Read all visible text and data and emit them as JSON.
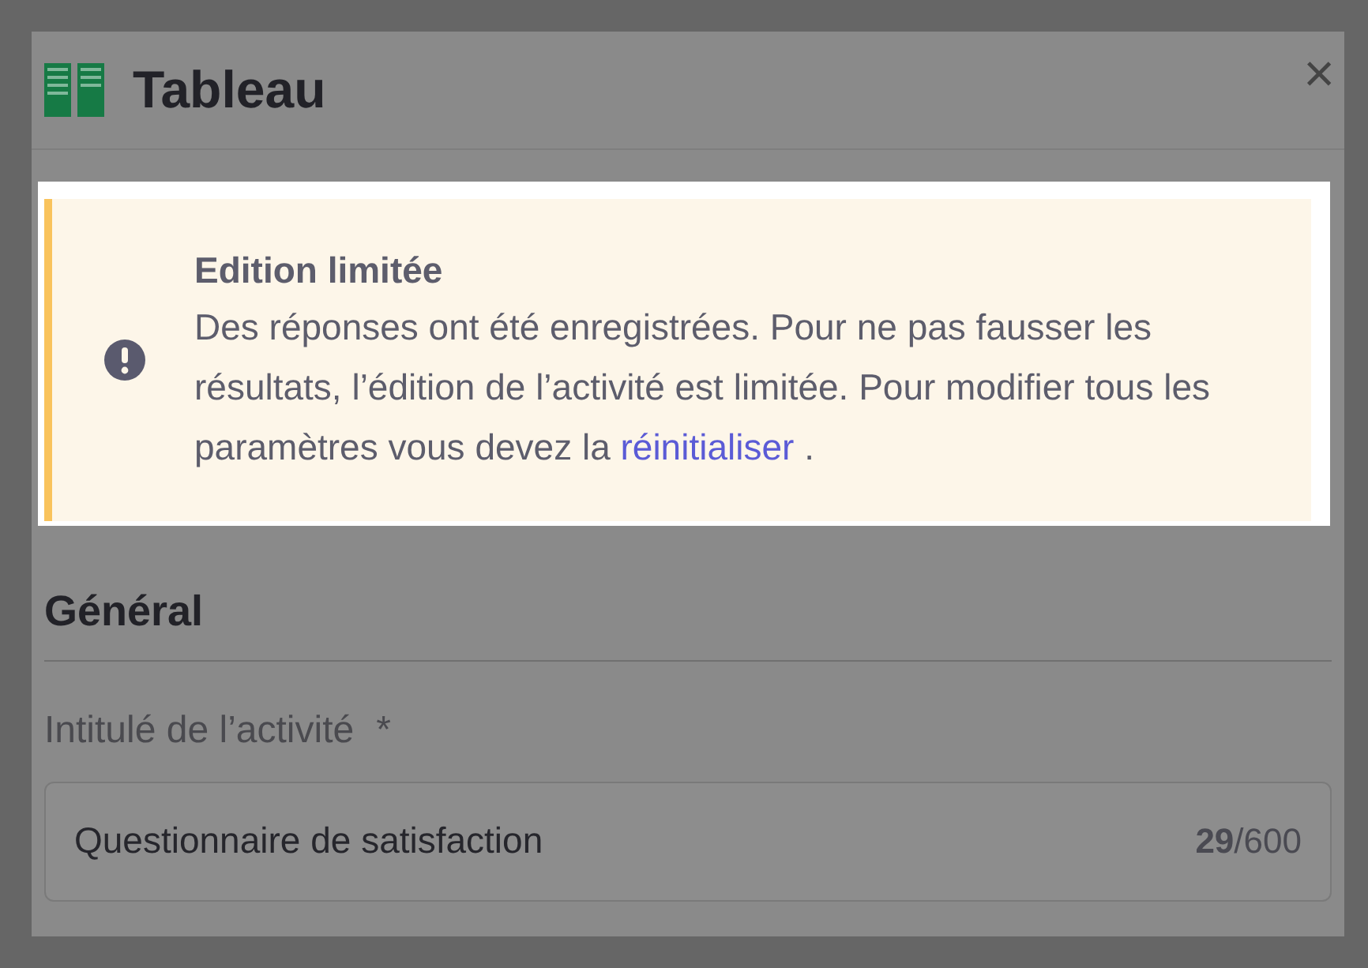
{
  "dialog": {
    "title": "Tableau",
    "close": "×"
  },
  "alert": {
    "title": "Edition limitée",
    "message": "Des réponses ont été enregistrées. Pour ne pas fausser les résultats, l’édition de l’activité est limitée. Pour modifier tous les paramètres vous devez la",
    "link": "réinitialiser",
    "after_link": "."
  },
  "section": {
    "title": "Général"
  },
  "field": {
    "label": "Intitulé de l’activité",
    "required_mark": "*",
    "value": "Questionnaire de satisfaction",
    "count": "29",
    "max": "/600"
  }
}
